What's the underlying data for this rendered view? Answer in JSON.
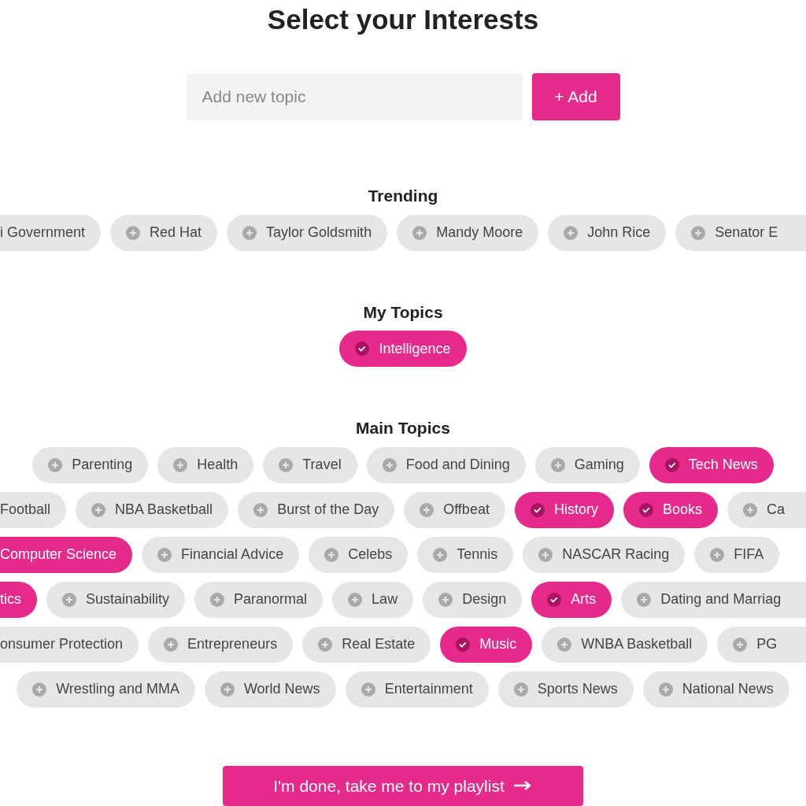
{
  "title": "Select your Interests",
  "new_topic": {
    "placeholder": "Add new topic",
    "button": "+ Add"
  },
  "trending": {
    "title": "Trending",
    "topics": [
      {
        "label": "i Government",
        "selected": false,
        "kind": "cut-left"
      },
      {
        "label": "Red Hat",
        "selected": false,
        "kind": "chip"
      },
      {
        "label": "Taylor Goldsmith",
        "selected": false,
        "kind": "chip"
      },
      {
        "label": "Mandy Moore",
        "selected": false,
        "kind": "chip"
      },
      {
        "label": "John Rice",
        "selected": false,
        "kind": "chip"
      },
      {
        "label": "Senator E",
        "selected": false,
        "kind": "cut-right"
      }
    ]
  },
  "my_topics": {
    "title": "My Topics",
    "topics": [
      {
        "label": "Intelligence",
        "selected": true,
        "kind": "chip"
      }
    ]
  },
  "main_topics": {
    "title": "Main Topics",
    "lines": [
      {
        "topics": [
          {
            "label": "Parenting",
            "selected": false,
            "kind": "chip"
          },
          {
            "label": "Health",
            "selected": false,
            "kind": "chip"
          },
          {
            "label": "Travel",
            "selected": false,
            "kind": "chip"
          },
          {
            "label": "Food and Dining",
            "selected": false,
            "kind": "chip"
          },
          {
            "label": "Gaming",
            "selected": false,
            "kind": "chip"
          },
          {
            "label": "Tech News",
            "selected": true,
            "kind": "chip"
          }
        ]
      },
      {
        "topics": [
          {
            "label": "Football",
            "selected": false,
            "kind": "cut-left"
          },
          {
            "label": "NBA Basketball",
            "selected": false,
            "kind": "chip"
          },
          {
            "label": "Burst of the Day",
            "selected": false,
            "kind": "chip"
          },
          {
            "label": "Offbeat",
            "selected": false,
            "kind": "chip"
          },
          {
            "label": "History",
            "selected": true,
            "kind": "chip"
          },
          {
            "label": "Books",
            "selected": true,
            "kind": "chip"
          },
          {
            "label": "Ca",
            "selected": false,
            "kind": "cut-right"
          }
        ]
      },
      {
        "topics": [
          {
            "label": "Computer Science",
            "selected": true,
            "kind": "cut-left"
          },
          {
            "label": "Financial Advice",
            "selected": false,
            "kind": "chip"
          },
          {
            "label": "Celebs",
            "selected": false,
            "kind": "chip"
          },
          {
            "label": "Tennis",
            "selected": false,
            "kind": "chip"
          },
          {
            "label": "NASCAR Racing",
            "selected": false,
            "kind": "chip"
          },
          {
            "label": "FIFA",
            "selected": false,
            "kind": "chip"
          }
        ]
      },
      {
        "topics": [
          {
            "label": "tics",
            "selected": true,
            "kind": "cut-left"
          },
          {
            "label": "Sustainability",
            "selected": false,
            "kind": "chip"
          },
          {
            "label": "Paranormal",
            "selected": false,
            "kind": "chip"
          },
          {
            "label": "Law",
            "selected": false,
            "kind": "chip"
          },
          {
            "label": "Design",
            "selected": false,
            "kind": "chip"
          },
          {
            "label": "Arts",
            "selected": true,
            "kind": "chip"
          },
          {
            "label": "Dating and Marriag",
            "selected": false,
            "kind": "cut-right"
          }
        ]
      },
      {
        "topics": [
          {
            "label": "onsumer Protection",
            "selected": false,
            "kind": "cut-left"
          },
          {
            "label": "Entrepreneurs",
            "selected": false,
            "kind": "chip"
          },
          {
            "label": "Real Estate",
            "selected": false,
            "kind": "chip"
          },
          {
            "label": "Music",
            "selected": true,
            "kind": "chip"
          },
          {
            "label": "WNBA Basketball",
            "selected": false,
            "kind": "chip"
          },
          {
            "label": "PG",
            "selected": false,
            "kind": "cut-right"
          }
        ]
      },
      {
        "topics": [
          {
            "label": "Wrestling and MMA",
            "selected": false,
            "kind": "chip"
          },
          {
            "label": "World News",
            "selected": false,
            "kind": "chip"
          },
          {
            "label": "Entertainment",
            "selected": false,
            "kind": "chip"
          },
          {
            "label": "Sports News",
            "selected": false,
            "kind": "chip"
          },
          {
            "label": "National News",
            "selected": false,
            "kind": "chip"
          }
        ]
      }
    ]
  },
  "done_button": "I'm done, take me to my playlist"
}
